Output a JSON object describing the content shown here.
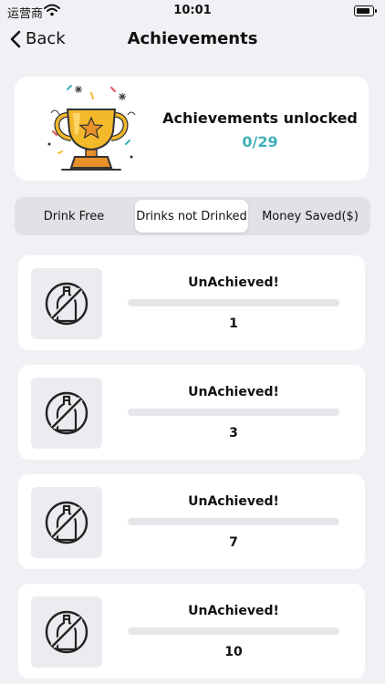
{
  "status_bar": {
    "carrier": "运营商",
    "time": "10:01"
  },
  "nav": {
    "back_label": "Back",
    "title": "Achievements"
  },
  "summary": {
    "title": "Achievements unlocked",
    "count": "0/29"
  },
  "tabs": [
    {
      "label": "Drink Free",
      "active": false
    },
    {
      "label": "Drinks not Drinked",
      "active": true
    },
    {
      "label": "Money Saved($)",
      "active": false
    }
  ],
  "achievements": [
    {
      "status": "UnAchieved!",
      "target": "1",
      "progress": 0,
      "icon": "no-drinking-icon"
    },
    {
      "status": "UnAchieved!",
      "target": "3",
      "progress": 0,
      "icon": "no-drinking-icon"
    },
    {
      "status": "UnAchieved!",
      "target": "7",
      "progress": 0,
      "icon": "no-drinking-icon"
    },
    {
      "status": "UnAchieved!",
      "target": "10",
      "progress": 0,
      "icon": "no-drinking-icon"
    }
  ],
  "colors": {
    "accent": "#3fb0b8",
    "background": "#f1f1f5",
    "trophy_gold": "#f4b92b"
  }
}
